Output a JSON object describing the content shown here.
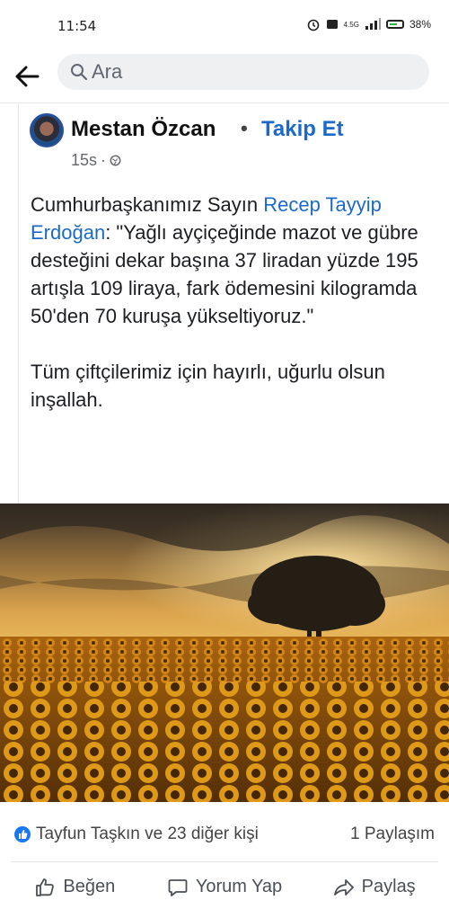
{
  "status_bar": {
    "time": "11:54",
    "network": "4.5G",
    "battery": "38%"
  },
  "search": {
    "placeholder": "Ara",
    "value": ""
  },
  "post": {
    "author": "Mestan Özcan",
    "separator": "•",
    "follow_label": "Takip Et",
    "time": "15s",
    "visibility_icon": "globe-icon",
    "text": {
      "intro": "Cumhurbaşkanımız Sayın ",
      "mention": "Recep Tayyip Erdoğan",
      "quote": ": \"Yağlı ayçiçeğinde mazot ve gübre desteğini dekar başına 37 liradan yüzde 195 artışla 109 liraya, fark ödemesini kilogramda 50'den 70 kuruşa yükseltiyoruz.\"",
      "closing": "Tüm çiftçilerimiz için hayırlı, uğurlu olsun inşallah."
    },
    "image": {
      "description_icon": "sunflower-field-photo"
    }
  },
  "engagement": {
    "reactions": "Tayfun Taşkın ve 23 diğer kişi",
    "shares": "1 Paylaşım"
  },
  "actions": [
    {
      "label": "Beğen",
      "icon": "like-icon"
    },
    {
      "label": "Yorum Yap",
      "icon": "comment-icon"
    },
    {
      "label": "Paylaş",
      "icon": "share-icon"
    }
  ],
  "colors": {
    "link": "#1b6ac9",
    "like_badge": "#1877f2",
    "text": "#1c1e21",
    "muted": "#65676b"
  }
}
